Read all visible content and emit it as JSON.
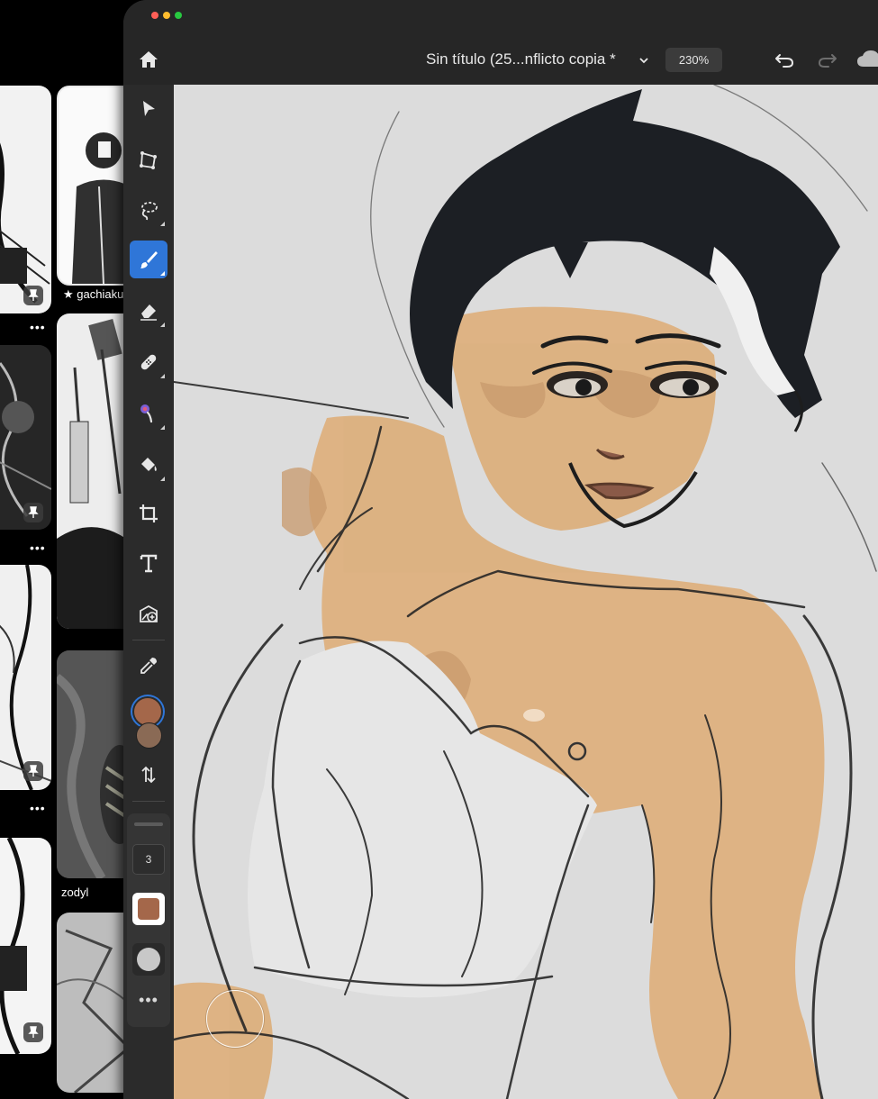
{
  "background": {
    "feed": {
      "card_labels": [
        "★ gachiaku",
        "zodyl"
      ],
      "more_glyph": "•••"
    }
  },
  "app": {
    "title": "Sin título (25...nflicto copia *",
    "zoom": "230%",
    "accent_color": "#2f76d8",
    "primary_color": "#a4674a",
    "secondary_color": "#8a6a55",
    "tools": [
      {
        "name": "select",
        "icon": "select-arrow-icon"
      },
      {
        "name": "transform",
        "icon": "transform-icon"
      },
      {
        "name": "lasso",
        "icon": "lasso-icon"
      },
      {
        "name": "brush",
        "icon": "paintbrush-icon",
        "active": true
      },
      {
        "name": "eraser",
        "icon": "eraser-icon"
      },
      {
        "name": "healing",
        "icon": "bandage-icon"
      },
      {
        "name": "liquify",
        "icon": "smudge-icon"
      },
      {
        "name": "fill",
        "icon": "paint-bucket-icon"
      },
      {
        "name": "crop",
        "icon": "crop-icon"
      },
      {
        "name": "text",
        "icon": "text-icon",
        "glyph": "T"
      },
      {
        "name": "place-image",
        "icon": "add-image-icon"
      },
      {
        "name": "eyedropper",
        "icon": "eyedropper-icon"
      },
      {
        "name": "swap-colors",
        "icon": "swap-arrows-icon"
      }
    ],
    "brush": {
      "size": "3",
      "more": "•••"
    }
  }
}
